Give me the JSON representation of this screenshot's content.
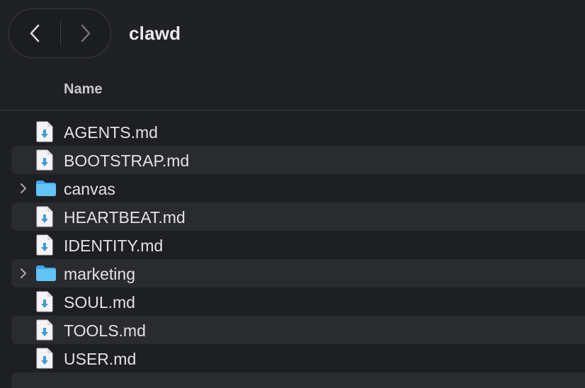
{
  "window": {
    "title": "clawd"
  },
  "toolbar": {
    "back_icon": "chevron-left-icon",
    "forward_icon": "chevron-right-icon"
  },
  "columns": {
    "name": "Name"
  },
  "items": [
    {
      "name": "AGENTS.md",
      "kind": "file"
    },
    {
      "name": "BOOTSTRAP.md",
      "kind": "file"
    },
    {
      "name": "canvas",
      "kind": "folder"
    },
    {
      "name": "HEARTBEAT.md",
      "kind": "file"
    },
    {
      "name": "IDENTITY.md",
      "kind": "file"
    },
    {
      "name": "marketing",
      "kind": "folder"
    },
    {
      "name": "SOUL.md",
      "kind": "file"
    },
    {
      "name": "TOOLS.md",
      "kind": "file"
    },
    {
      "name": "USER.md",
      "kind": "file"
    }
  ],
  "colors": {
    "background": "#1e1f22",
    "alt_row": "#2a2b2e",
    "folder_blue": "#5ec2f5",
    "file_arrow": "#3f9bd6"
  }
}
